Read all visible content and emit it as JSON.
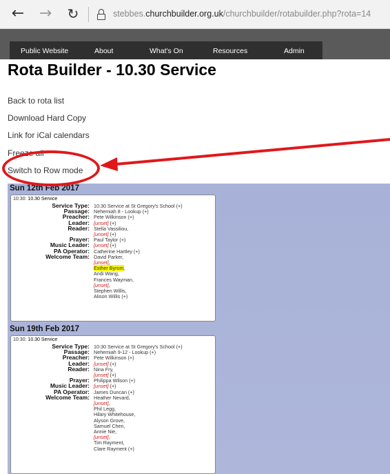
{
  "browser": {
    "back_icon": "arrow-left",
    "forward_icon": "arrow-right",
    "refresh_icon": "refresh",
    "lock_icon": "lock",
    "url_prefix": "stebbes.",
    "url_domain": "churchbuilder.org.uk",
    "url_path": "/churchbuilder/rotabuilder.php?rota=14"
  },
  "nav": {
    "items": [
      "Public Website",
      "About",
      "What's On",
      "Resources",
      "Admin"
    ]
  },
  "page": {
    "title": "Rota Builder - 10.30 Service",
    "links": [
      "Back to rota list",
      "Download Hard Copy",
      "Link for iCal calendars",
      "Freeze all",
      "Switch to Row mode"
    ]
  },
  "annotation": {
    "color": "#e0181b"
  },
  "weeks": [
    {
      "date": "Sun 12th Feb 2017",
      "card_time": "10:30:",
      "card_name": "10.30 Service",
      "roles": [
        {
          "label": "Service Type:",
          "lines": [
            {
              "t": "10:30 Service at St Gregory's School (+)"
            }
          ]
        },
        {
          "label": "Passage:",
          "lines": [
            {
              "t": "Nehemiah 8 - Lookup (+)"
            }
          ]
        },
        {
          "label": "Preacher:",
          "lines": [
            {
              "t": "Pete Wilkinson (+)"
            }
          ]
        },
        {
          "label": "Leader:",
          "lines": [
            {
              "u": "[unset]",
              "t": " (+)"
            }
          ]
        },
        {
          "label": "Reader:",
          "lines": [
            {
              "t": "Stella Vassiliou,"
            },
            {
              "u": "[unset]",
              "t": " (+)"
            }
          ]
        },
        {
          "label": "Prayer:",
          "lines": [
            {
              "t": "Paul Taylor (+)"
            }
          ]
        },
        {
          "label": "Music Leader:",
          "lines": [
            {
              "u": "[unset]",
              "t": " (+)"
            }
          ]
        },
        {
          "label": "PA Operator:",
          "lines": [
            {
              "t": "Catherine Hartley (+)"
            }
          ]
        },
        {
          "label": "Welcome Team:",
          "lines": [
            {
              "t": "David Parker,"
            },
            {
              "u": "[unset]",
              "t": ","
            },
            {
              "h": "Esther Byrom",
              "t": ","
            },
            {
              "t": "Andi Wang,"
            },
            {
              "t": "Frances Wayman,"
            },
            {
              "u": "[unset]",
              "t": ","
            },
            {
              "t": "Stephen Willis,"
            },
            {
              "t": "Alison Willis (+)"
            }
          ]
        }
      ]
    },
    {
      "date": "Sun 19th Feb 2017",
      "card_time": "10:30:",
      "card_name": "10.30 Service",
      "roles": [
        {
          "label": "Service Type:",
          "lines": [
            {
              "t": "10:30 Service at St Gregory's School (+)"
            }
          ]
        },
        {
          "label": "Passage:",
          "lines": [
            {
              "t": "Nehemiah 9-12 - Lookup (+)"
            }
          ]
        },
        {
          "label": "Preacher:",
          "lines": [
            {
              "t": "Pete Wilkinson (+)"
            }
          ]
        },
        {
          "label": "Leader:",
          "lines": [
            {
              "u": "[unset]",
              "t": " (+)"
            }
          ]
        },
        {
          "label": "Reader:",
          "lines": [
            {
              "t": "Nina Fry,"
            },
            {
              "u": "[unset]",
              "t": " (+)"
            }
          ]
        },
        {
          "label": "Prayer:",
          "lines": [
            {
              "t": "Philippa Wilson (+)"
            }
          ]
        },
        {
          "label": "Music Leader:",
          "lines": [
            {
              "u": "[unset]",
              "t": " (+)"
            }
          ]
        },
        {
          "label": "PA Operator:",
          "lines": [
            {
              "t": "James Duncan (+)"
            }
          ]
        },
        {
          "label": "Welcome Team:",
          "lines": [
            {
              "t": "Heather Nevard,"
            },
            {
              "u": "[unset]",
              "t": ","
            },
            {
              "t": "Phil Legg,"
            },
            {
              "t": "Hilary Whitehouse,"
            },
            {
              "t": "Alyson Grove,"
            },
            {
              "t": "Samuel Chen,"
            },
            {
              "t": "Annie Nie,"
            },
            {
              "u": "[unset]",
              "t": ","
            },
            {
              "t": "Tim Rayment,"
            },
            {
              "t": "Clare Rayment (+)"
            }
          ]
        }
      ]
    }
  ]
}
